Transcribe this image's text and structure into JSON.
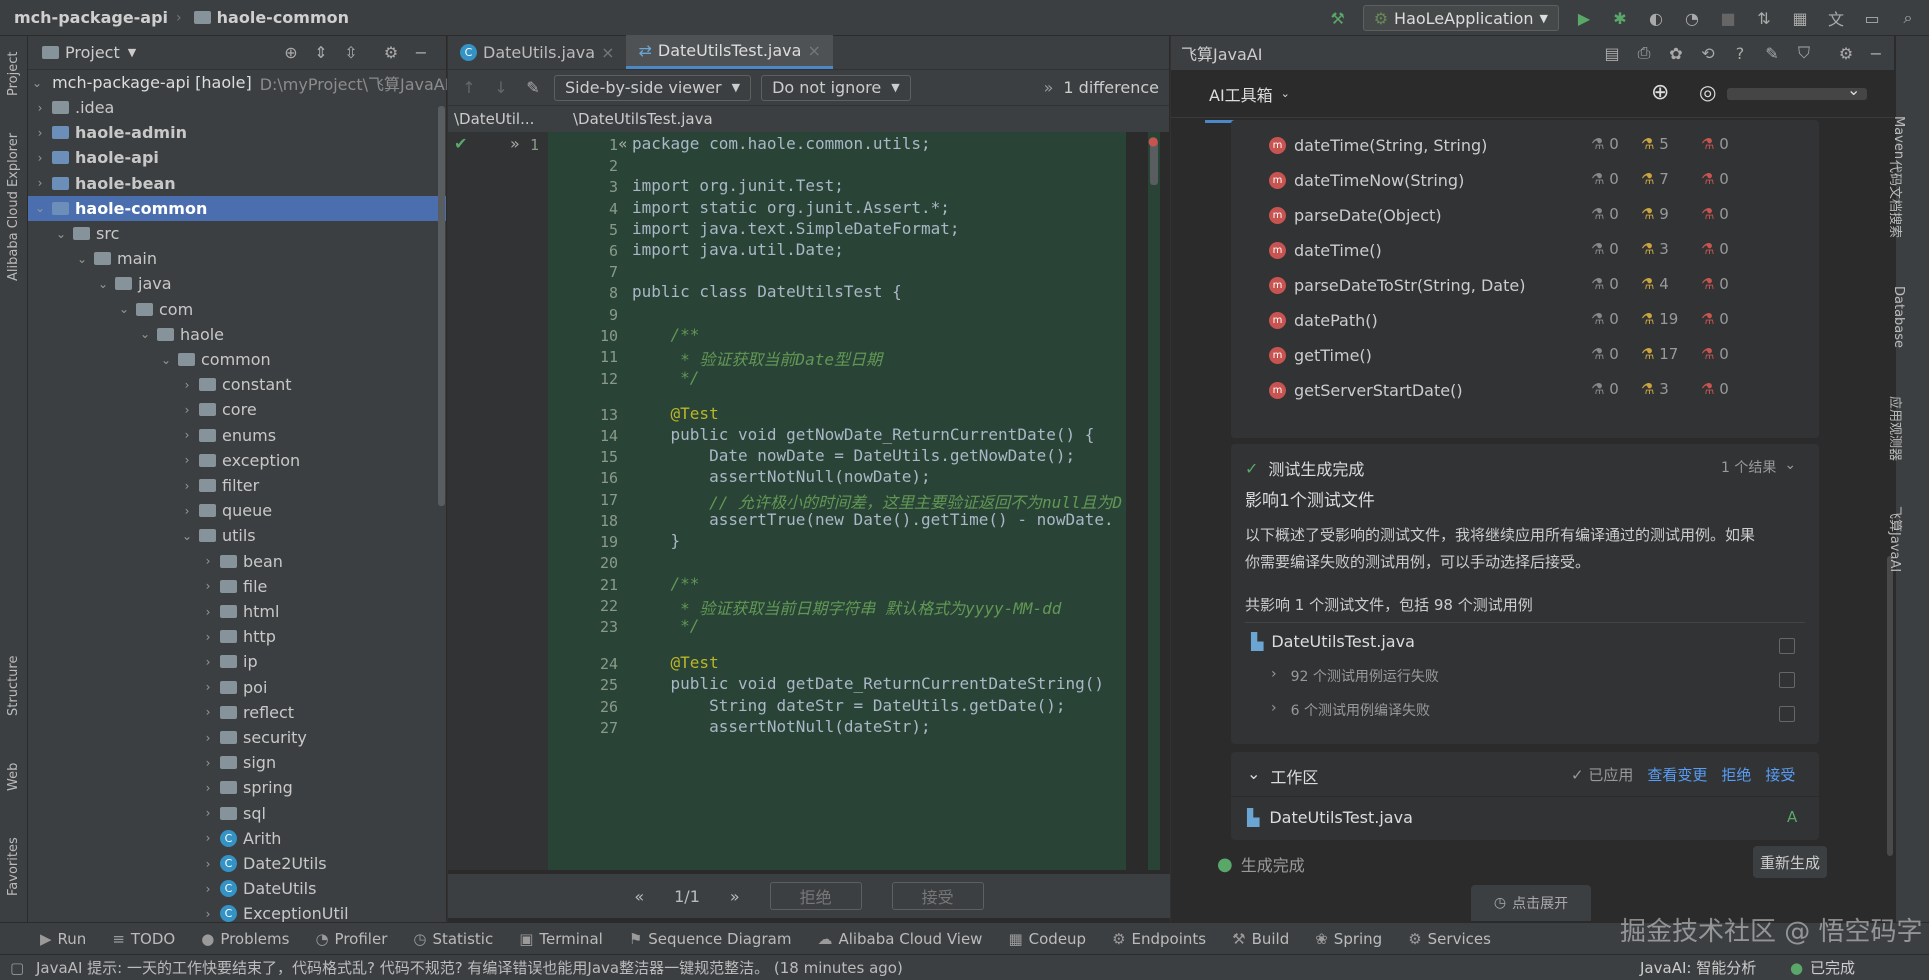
{
  "titlebar": {
    "project": "mch-package-api",
    "module": "haole-common",
    "run_config": "HaoLeApplication"
  },
  "left_tools": [
    "Project",
    "Alibaba Cloud Explorer",
    "Structure",
    "Web",
    "Favorites"
  ],
  "project_panel": {
    "title": "Project",
    "root": "mch-package-api [haole]",
    "root_path": "D:\\myProject\\飞算JavaAI\\m",
    "rows": [
      ".idea",
      "haole-admin",
      "haole-api",
      "haole-bean",
      "haole-common",
      "src",
      "main",
      "java",
      "com",
      "haole",
      "common",
      "constant",
      "core",
      "enums",
      "exception",
      "filter",
      "queue",
      "utils",
      "bean",
      "file",
      "html",
      "http",
      "ip",
      "poi",
      "reflect",
      "security",
      "sign",
      "spring",
      "sql",
      "Arith",
      "Date2Utils",
      "DateUtils",
      "ExceptionUtil"
    ]
  },
  "editor": {
    "tabs": [
      "DateUtils.java",
      "DateUtilsTest.java"
    ],
    "viewer": "Side-by-side viewer",
    "ignore": "Do not ignore",
    "differences": "1 difference",
    "path_left": "\\DateUtil...",
    "path_right": "\\DateUtilsTest.java",
    "left_line": "1",
    "lines": [
      {
        "n": "1",
        "t": "package com.haole.common.utils;"
      },
      {
        "n": "2",
        "t": ""
      },
      {
        "n": "3",
        "t": "import org.junit.Test;"
      },
      {
        "n": "4",
        "t": "import static org.junit.Assert.*;"
      },
      {
        "n": "5",
        "t": "import java.text.SimpleDateFormat;"
      },
      {
        "n": "6",
        "t": "import java.util.Date;"
      },
      {
        "n": "7",
        "t": ""
      },
      {
        "n": "8",
        "t": "public class DateUtilsTest {"
      },
      {
        "n": "9",
        "t": ""
      },
      {
        "n": "10",
        "t": "    /**"
      },
      {
        "n": "11",
        "t": "     * 验证获取当前Date型日期"
      },
      {
        "n": "12",
        "t": "     */"
      },
      {
        "n": "13",
        "t": "    @Test"
      },
      {
        "n": "14",
        "t": "    public void getNowDate_ReturnCurrentDate() {"
      },
      {
        "n": "15",
        "t": "        Date nowDate = DateUtils.getNowDate();"
      },
      {
        "n": "16",
        "t": "        assertNotNull(nowDate);"
      },
      {
        "n": "17",
        "t": "        // 允许极小的时间差，这里主要验证返回不为null且为D"
      },
      {
        "n": "18",
        "t": "        assertTrue(new Date().getTime() - nowDate."
      },
      {
        "n": "19",
        "t": "    }"
      },
      {
        "n": "20",
        "t": ""
      },
      {
        "n": "21",
        "t": "    /**"
      },
      {
        "n": "22",
        "t": "     * 验证获取当前日期字符串 默认格式为yyyy-MM-dd"
      },
      {
        "n": "23",
        "t": "     */"
      },
      {
        "n": "24",
        "t": "    @Test"
      },
      {
        "n": "25",
        "t": "    public void getDate_ReturnCurrentDateString()"
      },
      {
        "n": "26",
        "t": "        String dateStr = DateUtils.getDate();"
      },
      {
        "n": "27",
        "t": "        assertNotNull(dateStr);"
      }
    ],
    "pager": "1/1",
    "reject": "拒绝",
    "accept": "接受"
  },
  "ai": {
    "title": "飞算JavaAI",
    "toolbox": "AI工具箱",
    "methods": [
      {
        "name": "dateTime(String, String)",
        "a": "0",
        "b": "5",
        "c": "0"
      },
      {
        "name": "dateTimeNow(String)",
        "a": "0",
        "b": "7",
        "c": "0"
      },
      {
        "name": "parseDate(Object)",
        "a": "0",
        "b": "9",
        "c": "0"
      },
      {
        "name": "dateTime()",
        "a": "0",
        "b": "3",
        "c": "0"
      },
      {
        "name": "parseDateToStr(String, Date)",
        "a": "0",
        "b": "4",
        "c": "0"
      },
      {
        "name": "datePath()",
        "a": "0",
        "b": "19",
        "c": "0"
      },
      {
        "name": "getTime()",
        "a": "0",
        "b": "17",
        "c": "0"
      },
      {
        "name": "getServerStartDate()",
        "a": "0",
        "b": "3",
        "c": "0"
      }
    ],
    "gen_done": "测试生成完成",
    "result_count": "1 个结果",
    "affect": "影响1个测试文件",
    "desc1": "以下概述了受影响的测试文件，我将继续应用所有编译通过的测试用例。如果",
    "desc2": "你需要编译失败的测试用例，可以手动选择后接受。",
    "summary": "共影响 1 个测试文件，包括 98 个测试用例",
    "file": "DateUtilsTest.java",
    "fail_run": "92 个测试用例运行失败",
    "fail_compile": "6 个测试用例编译失败",
    "workspace": "工作区",
    "applied": "已应用",
    "view_changes": "查看变更",
    "reject": "拒绝",
    "accept": "接受",
    "ws_file": "DateUtilsTest.java",
    "ws_flag": "A",
    "complete": "生成完成",
    "regen": "重新生成",
    "expand": "点击展开"
  },
  "right_tools": [
    "Maven",
    "代码文档搜索",
    "Database",
    "应用观测器",
    "飞算JavaAI"
  ],
  "bottom_tabs": [
    "Run",
    "TODO",
    "Problems",
    "Profiler",
    "Statistic",
    "Terminal",
    "Sequence Diagram",
    "Alibaba Cloud View",
    "Codeup",
    "Endpoints",
    "Build",
    "Spring",
    "Services"
  ],
  "status": {
    "msg": "JavaAI 提示: 一天的工作快要结束了，代码格式乱? 代码不规范? 有编译错误也能用Java整洁器一键规范整洁。 (18 minutes ago)",
    "right": "JavaAI: 智能分析",
    "right2": "已完成",
    "watermark": "掘金技术社区 @ 悟空码字"
  },
  "colors": {
    "accent": "#4b6eaf",
    "diff_bg": "#294436",
    "tab_underline": "#4a88c7"
  }
}
